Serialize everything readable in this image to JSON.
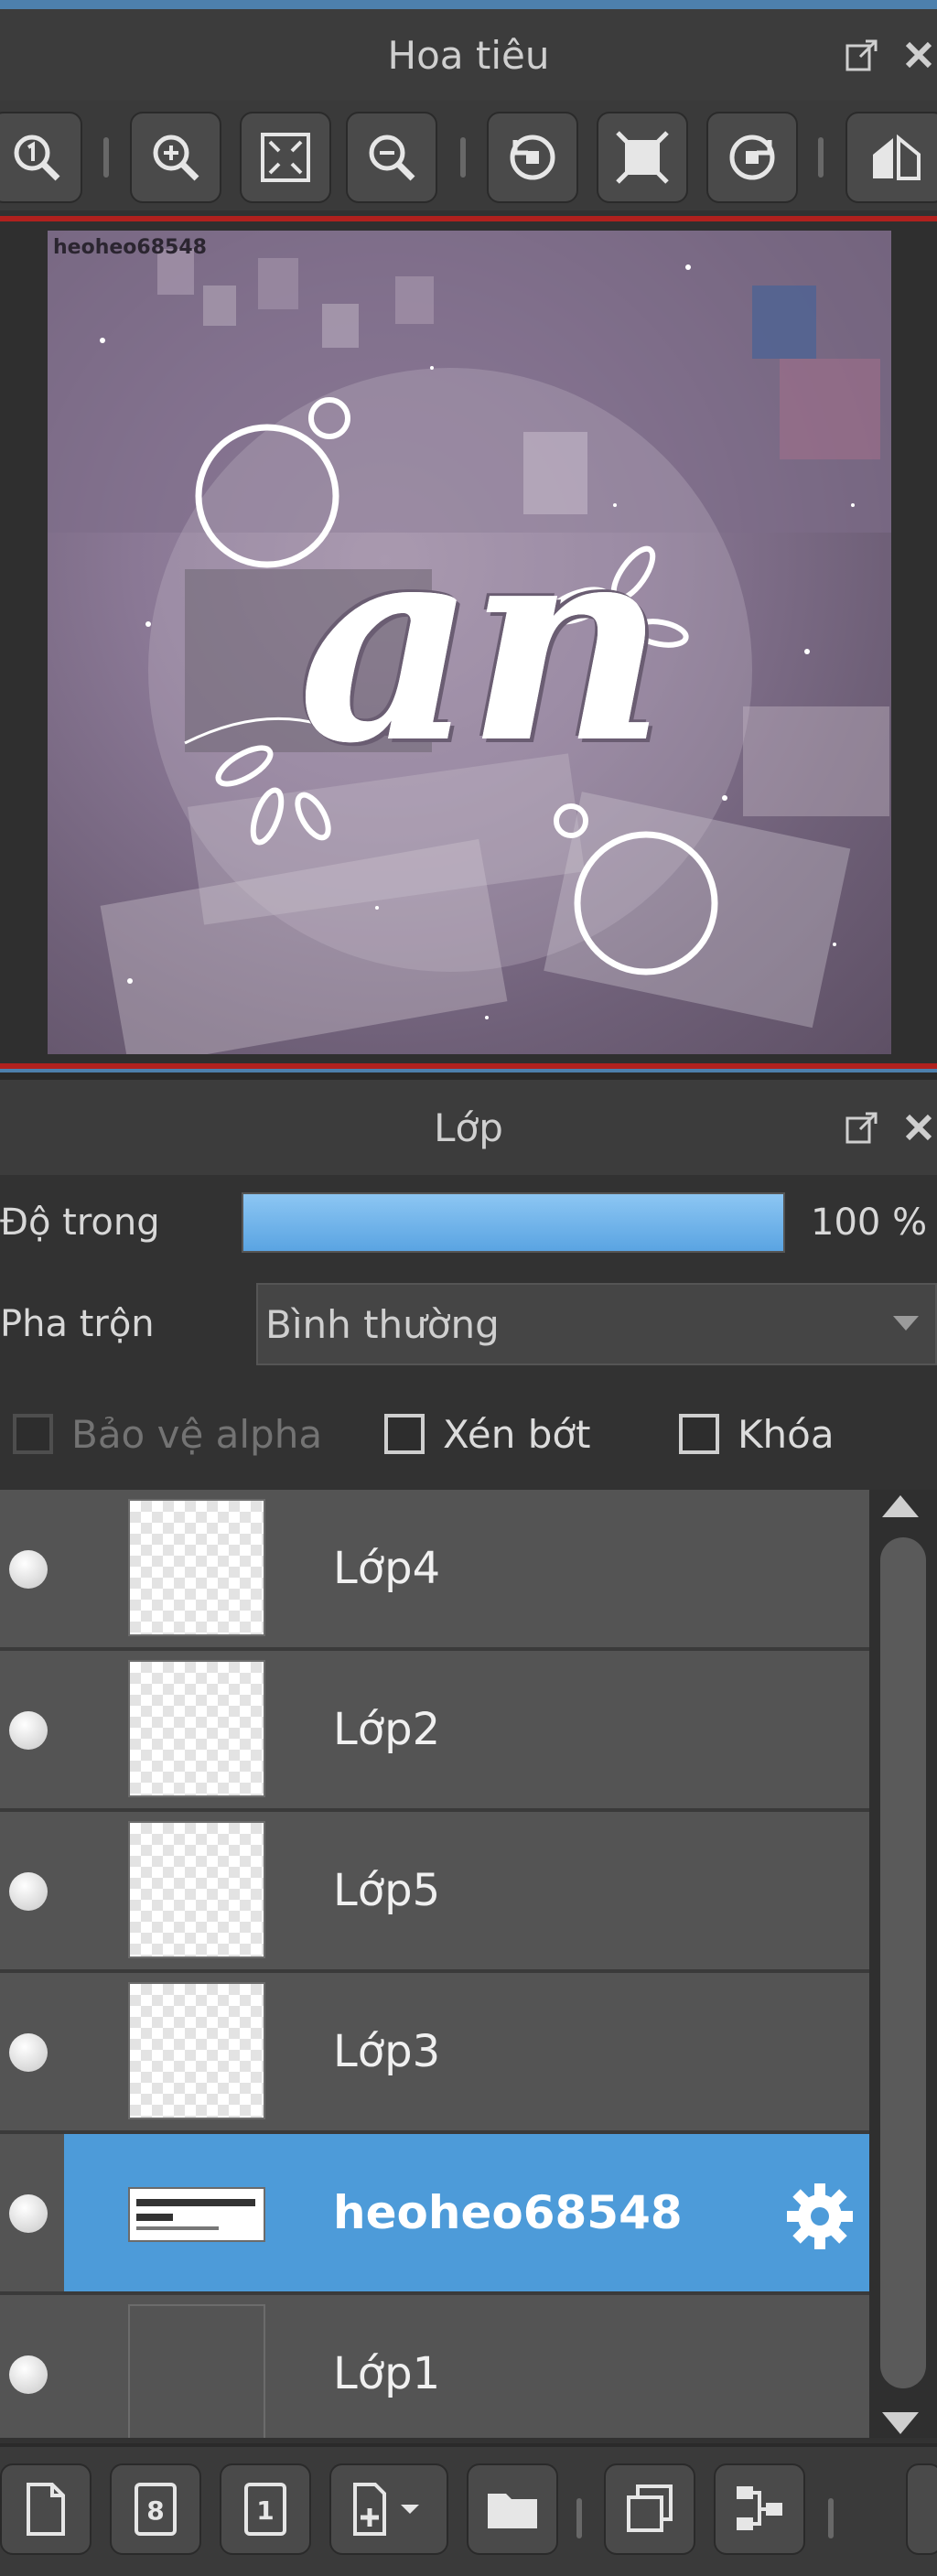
{
  "navigator": {
    "title": "Hoa tiêu",
    "watermark_text": "heoheo68548",
    "artwork_text": "an"
  },
  "navigator_toolbar": [
    {
      "name": "zoom-reset-icon"
    },
    {
      "name": "zoom-in-icon"
    },
    {
      "name": "fit-window-icon"
    },
    {
      "name": "zoom-out-icon"
    },
    {
      "name": "rotate-left-icon"
    },
    {
      "name": "actual-size-icon"
    },
    {
      "name": "rotate-right-icon"
    },
    {
      "name": "flip-horizontal-icon"
    }
  ],
  "layer_panel": {
    "title": "Lớp",
    "opacity_label": "Độ trong",
    "opacity_value": "100 %",
    "opacity_fraction": 1.0,
    "blend_label": "Pha trộn",
    "blend_value": "Bình thường",
    "protect_alpha_label": "Bảo vệ alpha",
    "clip_label": "Xén bớt",
    "lock_label": "Khóa",
    "layers": [
      {
        "name": "Lớp4",
        "thumb": "transparent",
        "selected": false
      },
      {
        "name": "Lớp2",
        "thumb": "transparent",
        "selected": false
      },
      {
        "name": "Lớp5",
        "thumb": "transparent",
        "selected": false
      },
      {
        "name": "Lớp3",
        "thumb": "transparent",
        "selected": false
      },
      {
        "name": "heoheo68548",
        "thumb": "text",
        "selected": true
      },
      {
        "name": "Lớp1",
        "thumb": "photo",
        "selected": false
      }
    ]
  },
  "bottom_toolbar": [
    {
      "name": "new-layer-icon"
    },
    {
      "name": "new-8bit-layer-icon"
    },
    {
      "name": "new-1bit-layer-icon"
    },
    {
      "name": "add-layer-dropdown-icon"
    },
    {
      "name": "new-folder-icon"
    },
    {
      "name": "duplicate-layer-icon"
    },
    {
      "name": "merge-layer-icon"
    }
  ],
  "colors": {
    "accent": "#4d9bd9",
    "panel_bg": "#323232",
    "row_bg": "#545454",
    "nav_border": "#b1211e"
  }
}
